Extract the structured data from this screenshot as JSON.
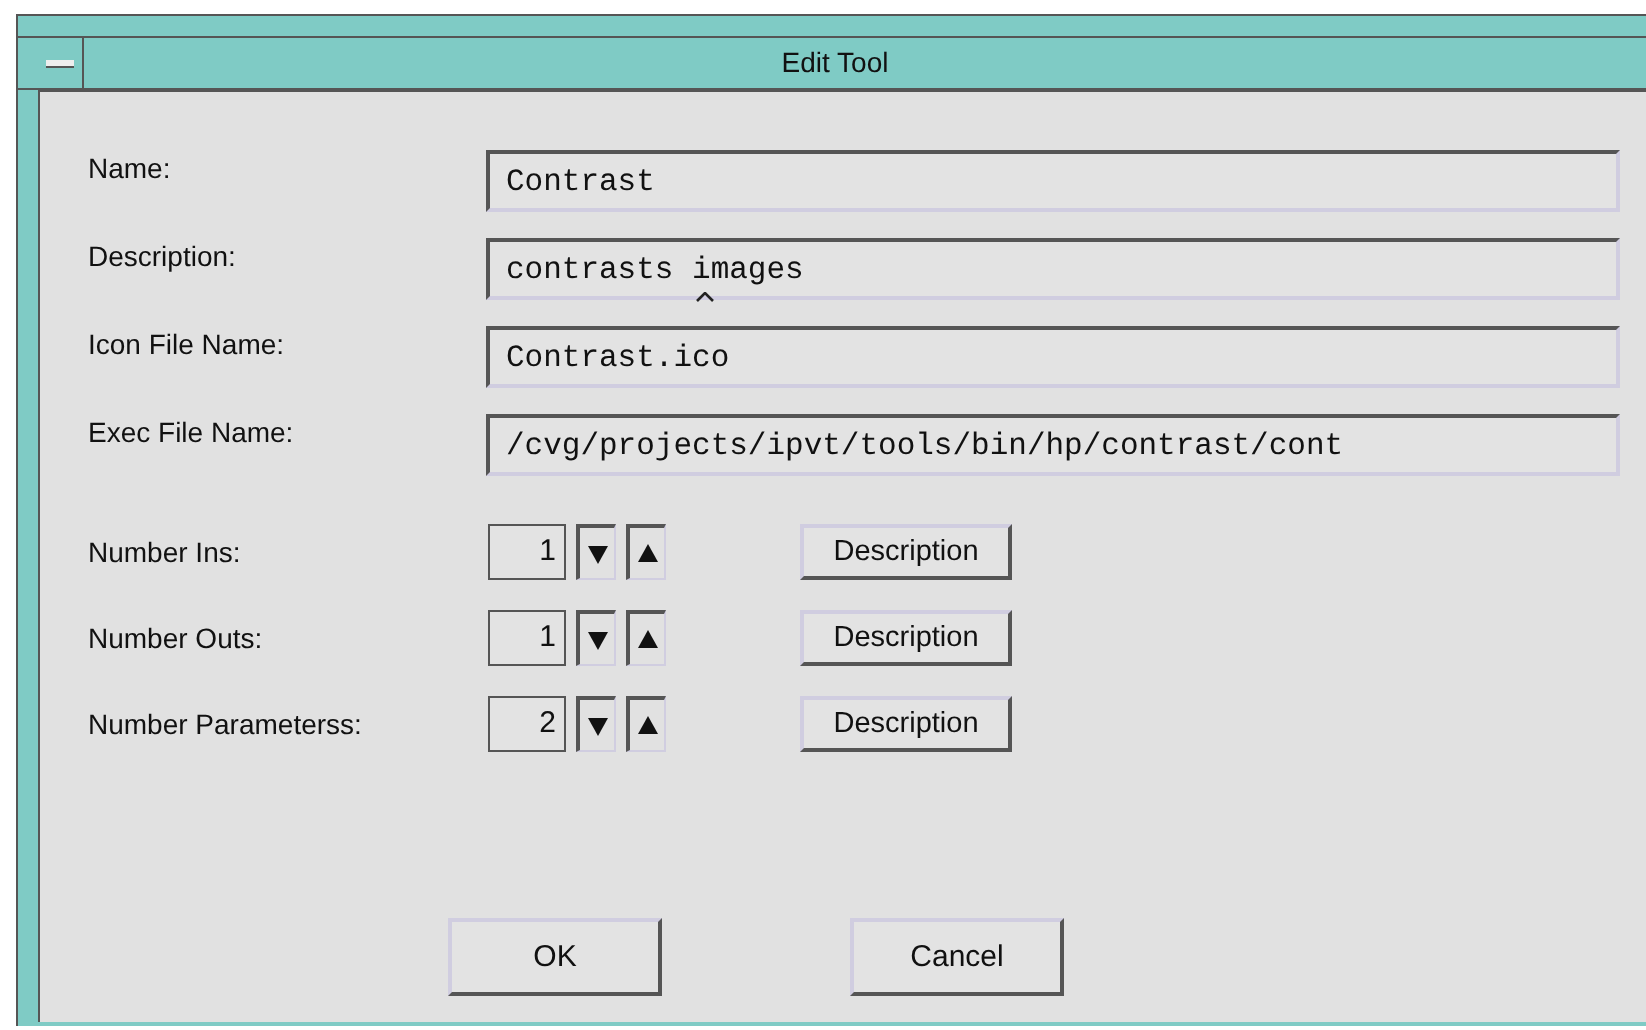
{
  "window": {
    "title": "Edit Tool"
  },
  "fields": [
    {
      "label": "Name:",
      "value": "Contrast",
      "focused": false
    },
    {
      "label": "Description:",
      "value": "contrasts images",
      "focused": true
    },
    {
      "label": "Icon File Name:",
      "value": "Contrast.ico",
      "focused": false
    },
    {
      "label": "Exec File Name:",
      "value": "/cvg/projects/ipvt/tools/bin/hp/contrast/cont",
      "focused": false
    }
  ],
  "spinners": [
    {
      "label": "Number Ins:",
      "value": "1",
      "button": "Description"
    },
    {
      "label": "Number Outs:",
      "value": "1",
      "button": "Description"
    },
    {
      "label": "Number Parameterss:",
      "value": "2",
      "button": "Description"
    }
  ],
  "buttons": [
    "OK",
    "Cancel"
  ]
}
